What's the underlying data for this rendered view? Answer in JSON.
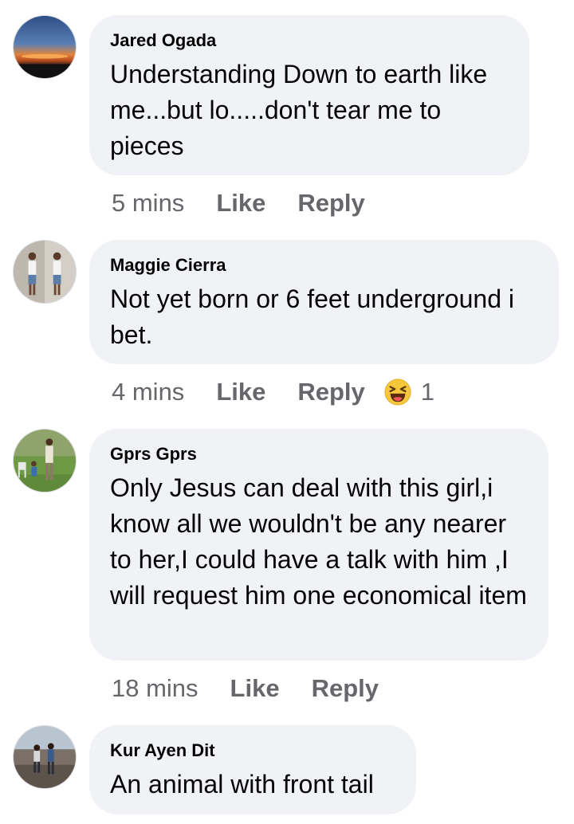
{
  "comments": [
    {
      "author": "Jared Ogada",
      "text": "Understanding Down to earth like me...but lo.....don't tear me to pieces",
      "time": "5 mins",
      "like_label": "Like",
      "reply_label": "Reply",
      "avatar_icon": "sunset-photo-avatar"
    },
    {
      "author": "Maggie Cierra",
      "text": "Not yet born or 6 feet underground i bet.",
      "time": "4 mins",
      "like_label": "Like",
      "reply_label": "Reply",
      "reaction": {
        "icon": "haha-emoji-icon",
        "count": "1"
      },
      "avatar_icon": "two-people-photo-avatar"
    },
    {
      "author": "Gprs Gprs",
      "text": "Only Jesus can deal with this girl,i know all we wouldn't be any nearer to her,I could have a talk with him ,I will request him one economical item",
      "time": "18 mins",
      "like_label": "Like",
      "reply_label": "Reply",
      "avatar_icon": "garden-people-photo-avatar"
    },
    {
      "author": "Kur Ayen Dit",
      "text": "An animal with front tail",
      "avatar_icon": "field-people-photo-avatar"
    }
  ],
  "colors": {
    "bubble": "#f0f2f5",
    "meta_text": "#65676b",
    "name_text": "#050505"
  }
}
